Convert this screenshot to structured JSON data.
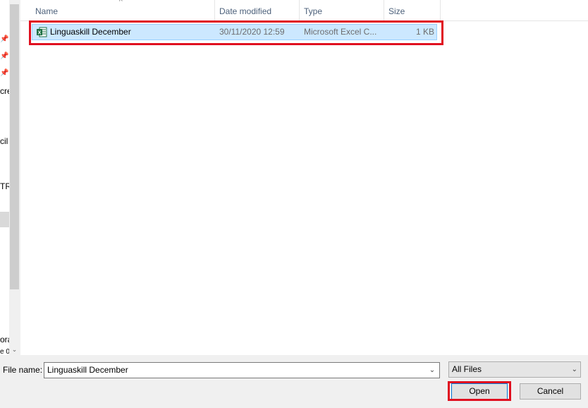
{
  "nav": {
    "fragments": [
      "cre",
      "cil",
      "TR",
      "ora",
      "e 0"
    ]
  },
  "columns": {
    "name": "Name",
    "date_modified": "Date modified",
    "type": "Type",
    "size": "Size"
  },
  "files": [
    {
      "name": "Linguaskill December",
      "date_modified": "30/11/2020 12:59",
      "type": "Microsoft Excel C...",
      "size": "1 KB",
      "icon": "excel-file-icon",
      "selected": true
    }
  ],
  "bottom_bar": {
    "file_name_label": "File name:",
    "file_name_value": "Linguaskill December",
    "file_type_selected": "All Files",
    "open_label": "Open",
    "cancel_label": "Cancel"
  },
  "colors": {
    "selection": "#cce8ff",
    "highlight_box": "#e01020",
    "excel_green": "#1d7044"
  }
}
